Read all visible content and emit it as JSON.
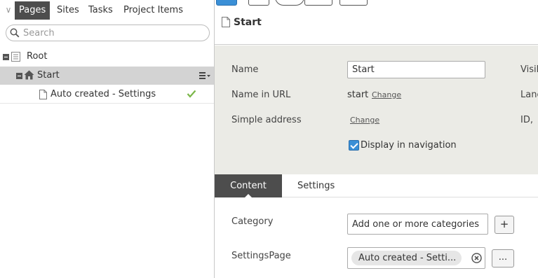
{
  "left_pane": {
    "tabs": [
      "Pages",
      "Sites",
      "Tasks",
      "Project Items"
    ],
    "search": {
      "placeholder": "Search",
      "value": ""
    },
    "tree": {
      "root": "Root",
      "start": "Start",
      "child": "Auto created - Settings"
    }
  },
  "right_pane": {
    "page_title": "Start",
    "props": {
      "name_label": "Name",
      "name_value": "Start",
      "url_label": "Name in URL",
      "url_value": "start",
      "url_change": "Change",
      "simple_label": "Simple address",
      "simple_change": "Change",
      "display_nav_label": "Display in navigation",
      "display_nav_checked": true,
      "right_labels": [
        "Visil",
        "Lanc",
        "ID,"
      ]
    },
    "content_tabs": [
      "Content",
      "Settings"
    ],
    "content": {
      "category_label": "Category",
      "category_placeholder": "Add one or more categories",
      "add_button": "+",
      "settings_page_label": "SettingsPage",
      "settings_page_value": "Auto created - Setti...",
      "browse_button": "..."
    }
  },
  "colors": {
    "selected_row": "#d3d3d3",
    "active_tab": "#4d4d4d",
    "props_bg": "#ebebe6",
    "checkmark": "#7ab648",
    "checkbox": "#3a8fd6"
  }
}
